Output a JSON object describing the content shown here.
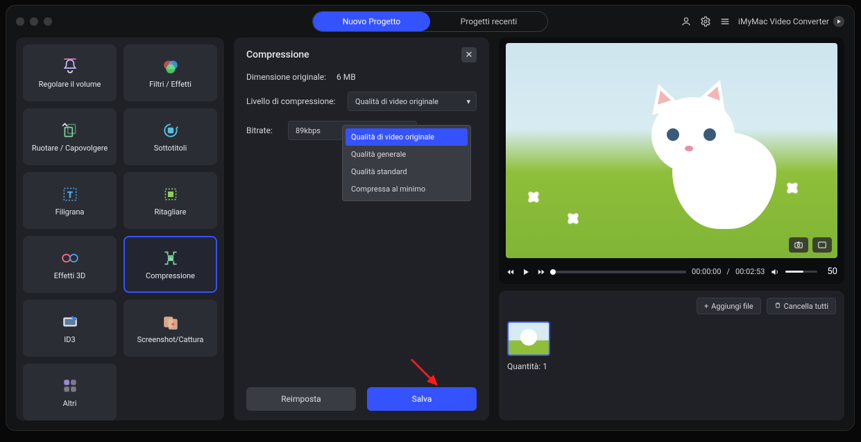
{
  "header": {
    "tab_new": "Nuovo Progetto",
    "tab_recent": "Progetti recenti",
    "app_title": "iMyMac Video Converter"
  },
  "sidebar": {
    "tools": [
      {
        "label": "Regolare il volume",
        "icon": "volume-bell-icon"
      },
      {
        "label": "Filtri / Effetti",
        "icon": "filters-icon"
      },
      {
        "label": "Ruotare / Capovolgere",
        "icon": "rotate-icon"
      },
      {
        "label": "Sottotitoli",
        "icon": "subtitles-icon"
      },
      {
        "label": "Filigrana",
        "icon": "watermark-icon"
      },
      {
        "label": "Ritagliare",
        "icon": "crop-icon"
      },
      {
        "label": "Effetti 3D",
        "icon": "3d-icon"
      },
      {
        "label": "Compressione",
        "icon": "compress-icon",
        "selected": true
      },
      {
        "label": "ID3",
        "icon": "id3-icon"
      },
      {
        "label": "Screenshot/Cattura",
        "icon": "capture-icon"
      },
      {
        "label": "Altri",
        "icon": "more-icon"
      }
    ]
  },
  "center": {
    "title": "Compressione",
    "original_size_label": "Dimensione originale:",
    "original_size_value": "6 MB",
    "compression_level_label": "Livello di compressione:",
    "compression_level_value": "Qualità di video originale",
    "options": [
      "Qualità di video originale",
      "Qualità generale",
      "Qualità standard",
      "Compressa al minimo"
    ],
    "bitrate_label": "Bitrate:",
    "bitrate_value": "89kbps",
    "reset_label": "Reimposta",
    "save_label": "Salva"
  },
  "preview": {
    "time_current": "00:00:00",
    "time_total": "00:02:53",
    "volume": "50"
  },
  "bottom": {
    "add_file": "Aggiungi file",
    "delete_all": "Cancella tutti",
    "quantity_label": "Quantità:",
    "quantity_value": "1"
  }
}
